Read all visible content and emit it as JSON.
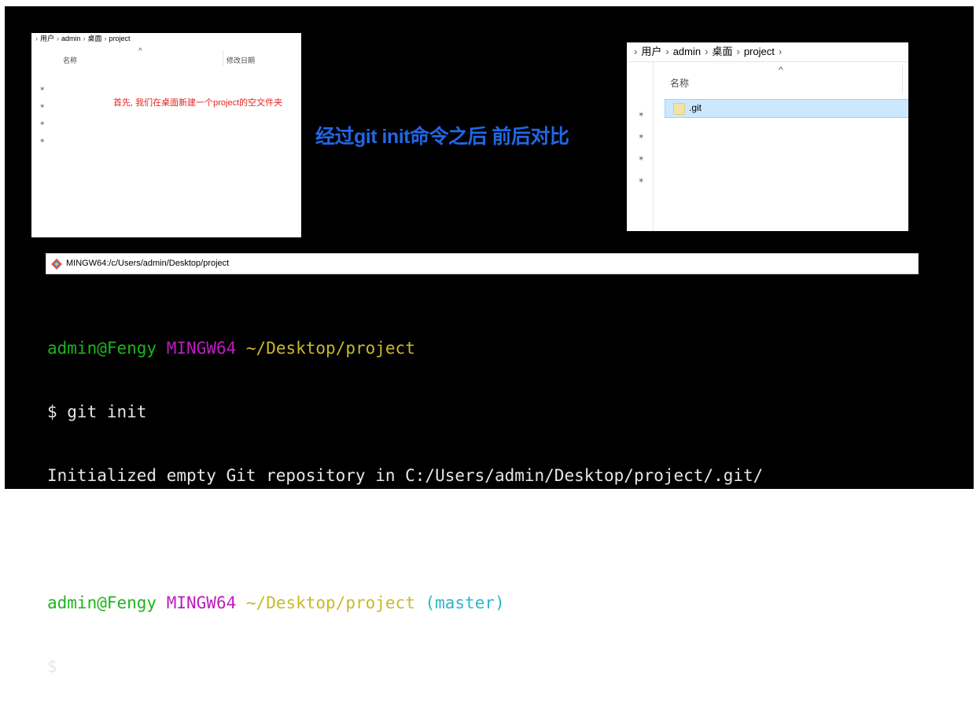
{
  "left_explorer": {
    "breadcrumb": [
      "用户",
      "admin",
      "桌面",
      "project"
    ],
    "column_name": "名称",
    "column_modified": "修改日期",
    "note": "首先, 我们在桌面新建一个project的空文件夹"
  },
  "right_explorer": {
    "breadcrumb": [
      "用户",
      "admin",
      "桌面",
      "project"
    ],
    "column_name": "名称",
    "file": ".git"
  },
  "caption": "经过git init命令之后 前后对比",
  "terminal": {
    "title": "MINGW64:/c/Users/admin/Desktop/project",
    "prompt1": {
      "user": "admin@Fengy",
      "host": "MINGW64",
      "path": "~/Desktop/project"
    },
    "command": "$ git init",
    "output": "Initialized empty Git repository in C:/Users/admin/Desktop/project/.git/",
    "prompt2": {
      "user": "admin@Fengy",
      "host": "MINGW64",
      "path": "~/Desktop/project",
      "branch": "(master)"
    },
    "cursor_line": "$"
  },
  "colors": {
    "caption": "#2167e6",
    "note": "#e8231f",
    "user": "#1db41d",
    "host": "#bf1bbf",
    "path": "#c9b92a",
    "branch": "#29b6c4"
  }
}
